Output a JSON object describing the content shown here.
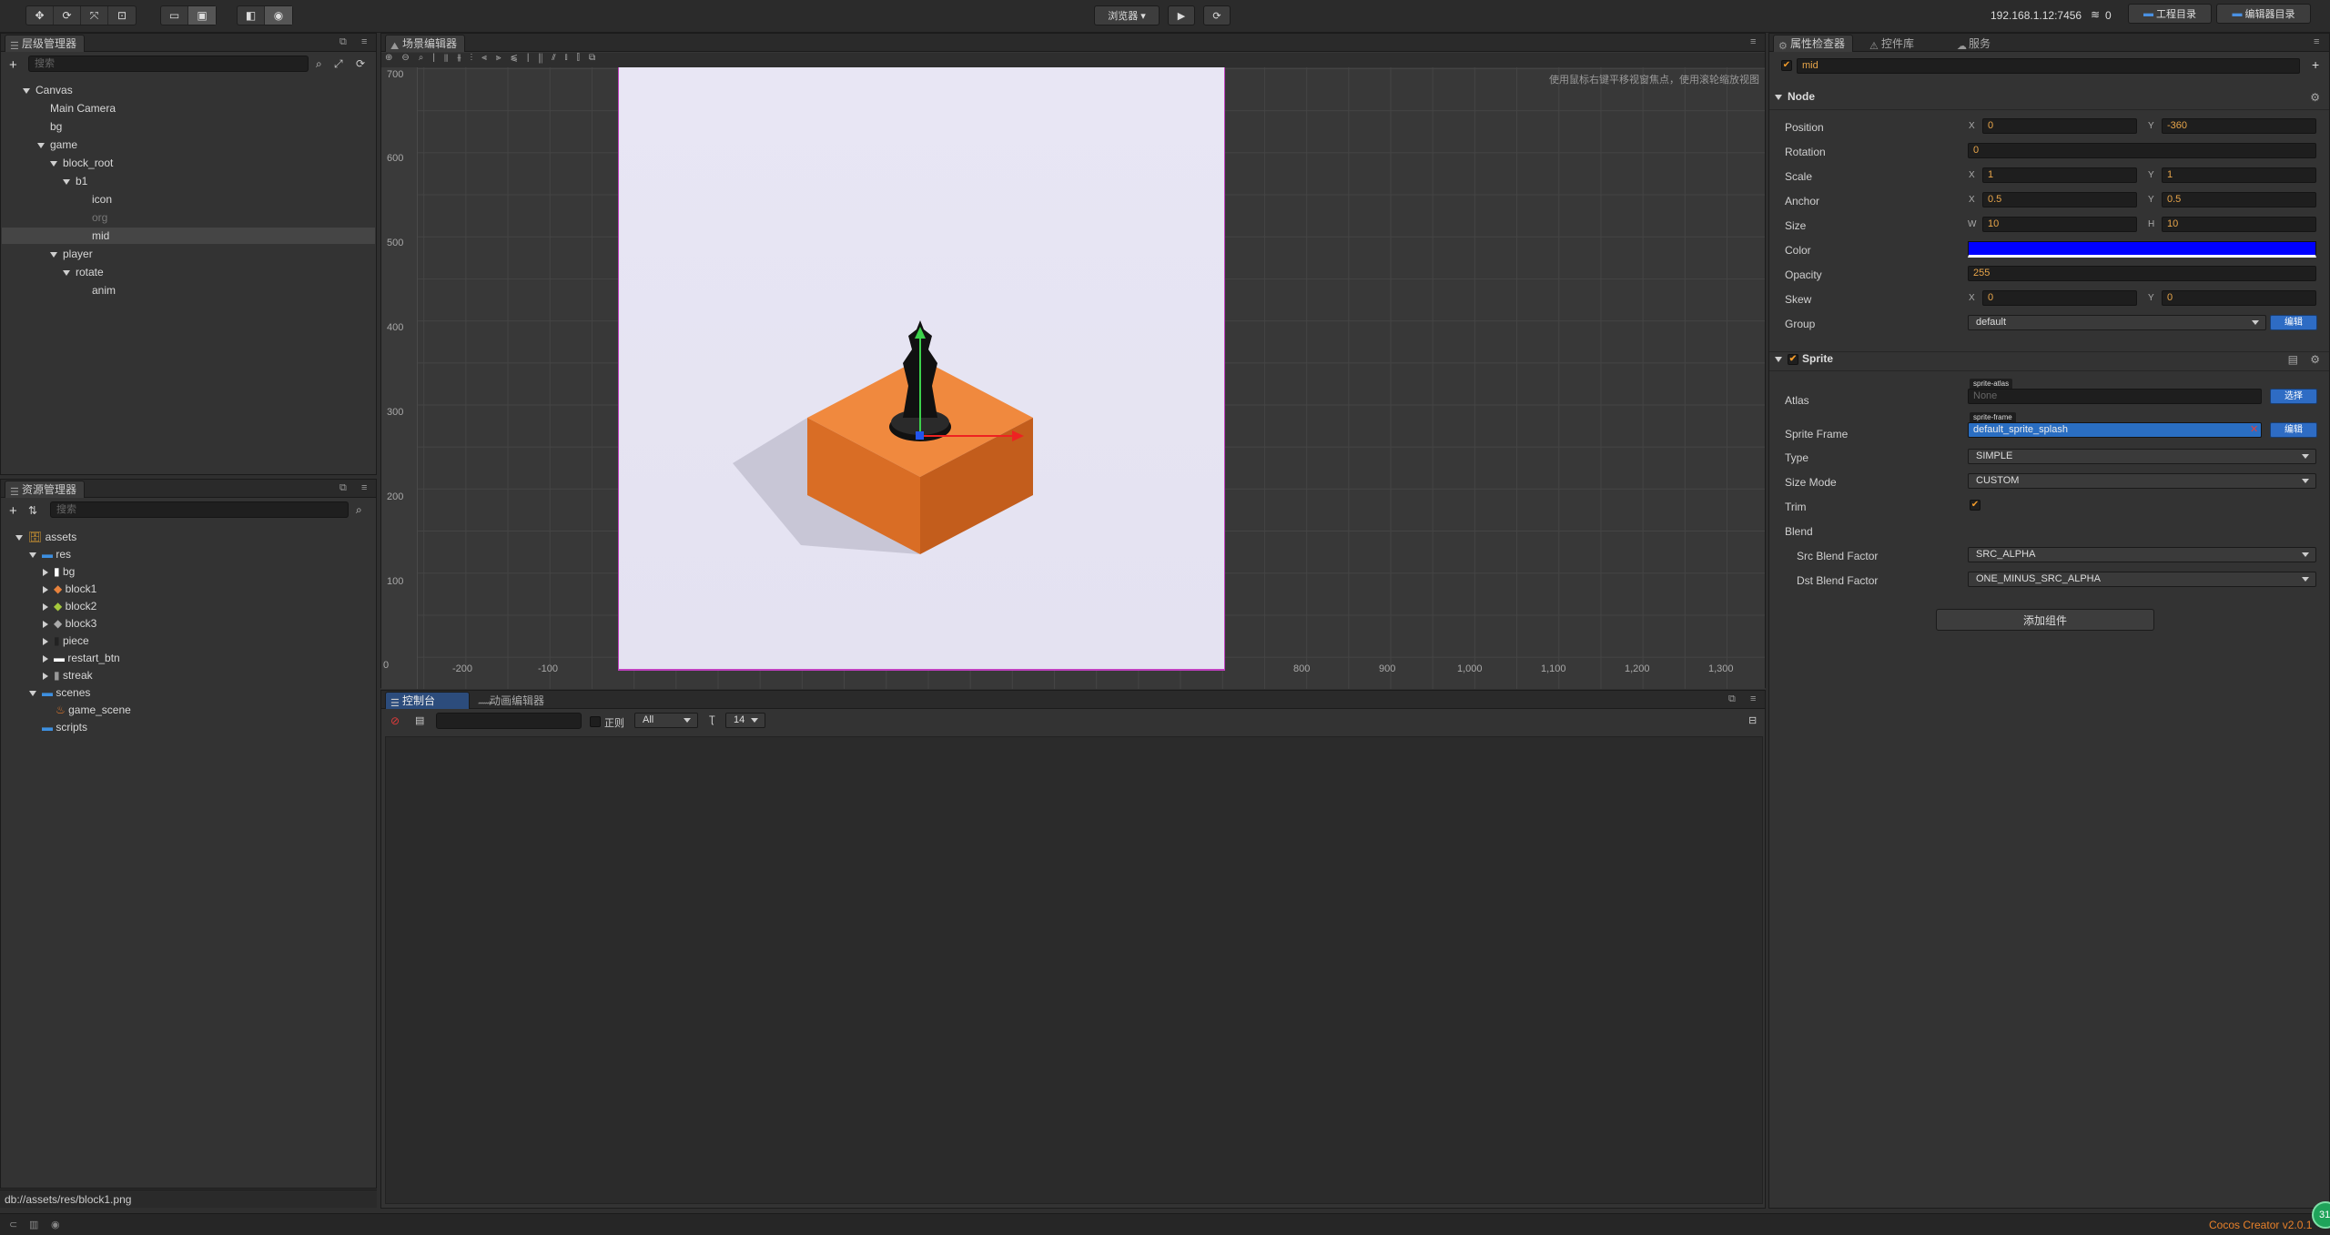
{
  "toolbar": {
    "preview_select": "浏览器",
    "ip": "192.168.1.12:7456",
    "conn_count": "0",
    "project_btn": "工程目录",
    "editor_btn": "编辑器目录"
  },
  "hierarchy": {
    "tab": "层级管理器",
    "search_placeholder": "搜索",
    "nodes": [
      "Canvas",
      "Main Camera",
      "bg",
      "game",
      "block_root",
      "b1",
      "icon",
      "org",
      "mid",
      "player",
      "rotate",
      "anim"
    ]
  },
  "assets": {
    "tab": "资源管理器",
    "search_placeholder": "搜索",
    "items": [
      "assets",
      "res",
      "bg",
      "block1",
      "block2",
      "block3",
      "piece",
      "restart_btn",
      "streak",
      "scenes",
      "game_scene",
      "scripts"
    ],
    "status_path": "db://assets/res/block1.png"
  },
  "scene": {
    "tab": "场景编辑器",
    "hint": "使用鼠标右键平移视窗焦点，使用滚轮缩放视图",
    "y_ticks": [
      "700",
      "600",
      "500",
      "400",
      "300",
      "200",
      "100",
      "0"
    ],
    "x_ticks": [
      "-200",
      "-100",
      "800",
      "900",
      "1,000",
      "1,100",
      "1,200",
      "1,300"
    ]
  },
  "console": {
    "tab": "控制台",
    "tab2": "动画编辑器",
    "regex_label": "正则",
    "level_select": "All",
    "font_size": "14"
  },
  "inspector": {
    "tabs": [
      "属性检查器",
      "控件库",
      "服务"
    ],
    "node_name": "mid",
    "node_section": "Node",
    "position_label": "Position",
    "position_x": "0",
    "position_y": "-360",
    "rotation_label": "Rotation",
    "rotation": "0",
    "scale_label": "Scale",
    "scale_x": "1",
    "scale_y": "1",
    "anchor_label": "Anchor",
    "anchor_x": "0.5",
    "anchor_y": "0.5",
    "size_label": "Size",
    "size_w": "10",
    "size_h": "10",
    "color_label": "Color",
    "color_value": "#0000ff",
    "opacity_label": "Opacity",
    "opacity": "255",
    "skew_label": "Skew",
    "skew_x": "0",
    "skew_y": "0",
    "group_label": "Group",
    "group": "default",
    "group_edit": "编辑",
    "sprite_section": "Sprite",
    "atlas_label": "Atlas",
    "atlas_tag": "sprite-atlas",
    "atlas_value": "None",
    "atlas_btn": "选择",
    "frame_label": "Sprite Frame",
    "frame_tag": "sprite-frame",
    "frame_value": "default_sprite_splash",
    "frame_btn": "编辑",
    "type_label": "Type",
    "type": "SIMPLE",
    "sizemode_label": "Size Mode",
    "sizemode": "CUSTOM",
    "trim_label": "Trim",
    "blend_label": "Blend",
    "src_label": "Src Blend Factor",
    "src": "SRC_ALPHA",
    "dst_label": "Dst Blend Factor",
    "dst": "ONE_MINUS_SRC_ALPHA",
    "add_component": "添加组件"
  },
  "footer": {
    "version": "Cocos Creator v2.0.1",
    "badge": "31"
  },
  "axis_labels": {
    "x": "X",
    "y": "Y",
    "w": "W",
    "h": "H"
  }
}
